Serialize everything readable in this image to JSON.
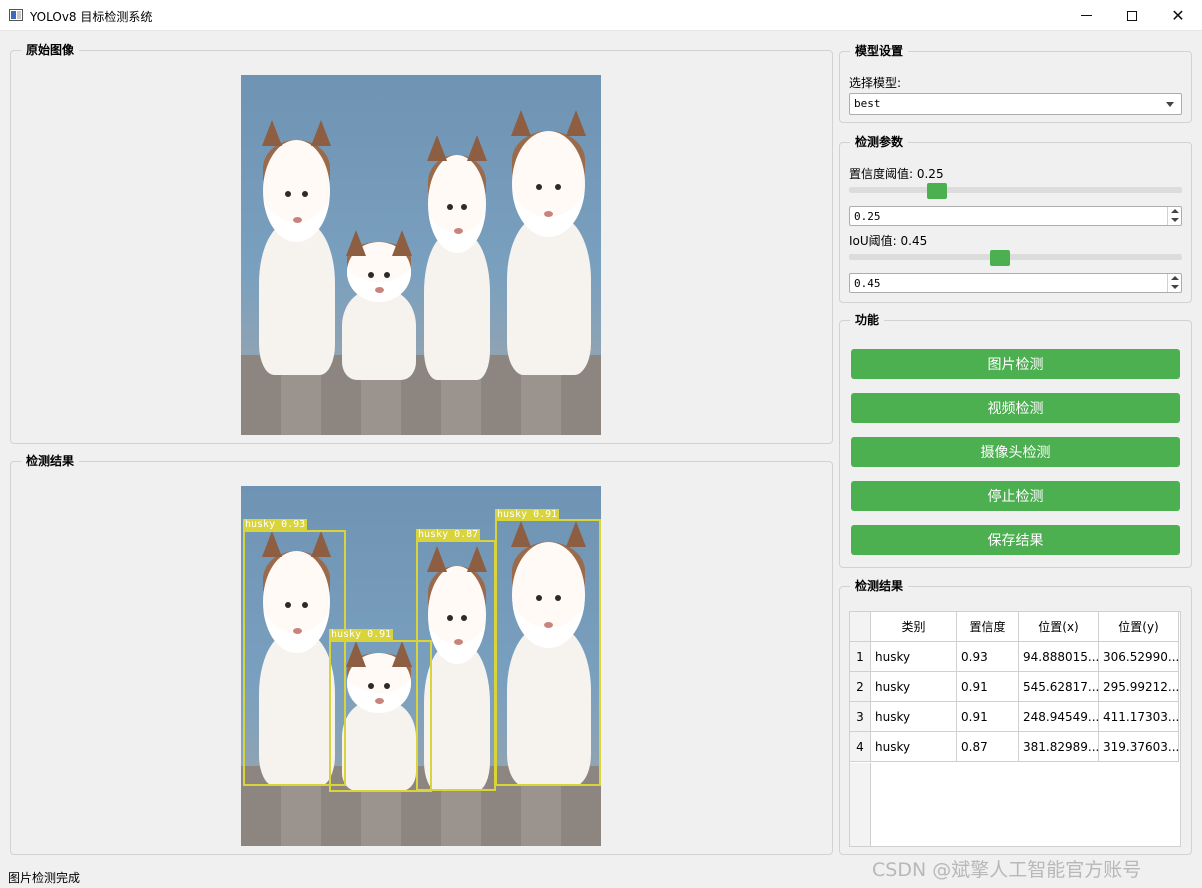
{
  "window": {
    "title": "YOLOv8 目标检测系统"
  },
  "original_image": {
    "title": "原始图像"
  },
  "result_image": {
    "title": "检测结果",
    "detections": [
      {
        "label": "husky 0.93"
      },
      {
        "label": "husky 0.91"
      },
      {
        "label": "husky 0.87"
      },
      {
        "label": "husky 0.91"
      }
    ]
  },
  "model_settings": {
    "title": "模型设置",
    "select_label": "选择模型:",
    "selected_model": "best"
  },
  "params": {
    "title": "检测参数",
    "confidence_label": "置信度阈值: 0.25",
    "confidence_value": "0.25",
    "iou_label": "IoU阈值: 0.45",
    "iou_value": "0.45"
  },
  "functions": {
    "title": "功能",
    "buttons": [
      "图片检测",
      "视频检测",
      "摄像头检测",
      "停止检测",
      "保存结果"
    ]
  },
  "results_table": {
    "title": "检测结果",
    "headers": [
      "类别",
      "置信度",
      "位置(x)",
      "位置(y)"
    ],
    "rows": [
      {
        "index": "1",
        "cls": "husky",
        "conf": "0.93",
        "x": "94.888015...",
        "y": "306.52990..."
      },
      {
        "index": "2",
        "cls": "husky",
        "conf": "0.91",
        "x": "545.62817...",
        "y": "295.99212..."
      },
      {
        "index": "3",
        "cls": "husky",
        "conf": "0.91",
        "x": "248.94549...",
        "y": "411.17303..."
      },
      {
        "index": "4",
        "cls": "husky",
        "conf": "0.87",
        "x": "381.82989...",
        "y": "319.37603..."
      }
    ]
  },
  "status_bar": {
    "text": "图片检测完成"
  },
  "watermark": {
    "text": "CSDN @斌擎人工智能官方账号"
  },
  "colors": {
    "accent": "#4caf50",
    "detection_box": "#d8d43a"
  }
}
